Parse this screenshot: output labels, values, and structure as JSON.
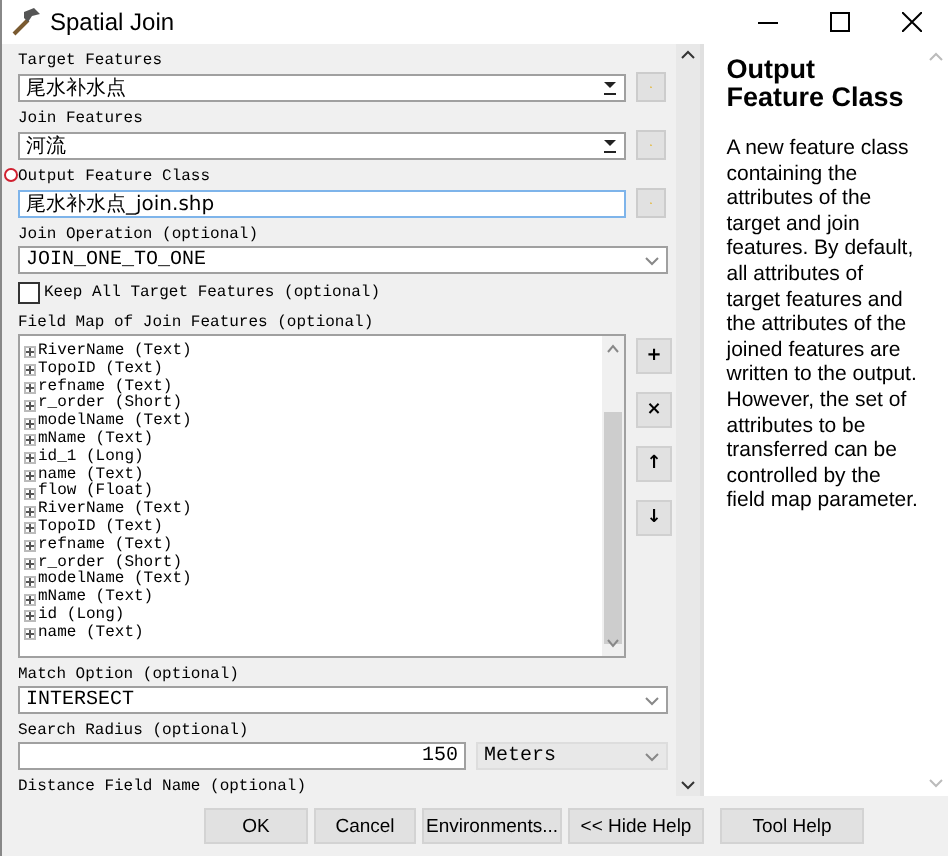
{
  "window": {
    "title": "Spatial Join"
  },
  "parameters": [
    {
      "kind": "combo",
      "label": "Target Features",
      "value": "尾水补水点",
      "browse": true,
      "error": false
    },
    {
      "kind": "combo",
      "label": "Join Features",
      "value": "河流",
      "browse": true,
      "error": false
    },
    {
      "kind": "text",
      "label": "Output Feature Class",
      "value": "尾水补水点_join.shp",
      "browse": true,
      "error": true
    },
    {
      "kind": "select",
      "label": "Join Operation (optional)",
      "value": "JOIN_ONE_TO_ONE",
      "browse": false,
      "error": false
    },
    {
      "kind": "checkbox",
      "label": "Keep All Target Features (optional)",
      "checked": false,
      "browse": false,
      "error": false
    },
    {
      "kind": "fieldmap",
      "label": "Field Map of Join Features (optional)",
      "browse": false,
      "error": false,
      "tools": [
        "+",
        "×",
        "↑",
        "↓"
      ],
      "fields": [
        {
          "text": "RiverName (Text)",
          "expanded": false
        },
        {
          "text": "TopoID (Text)",
          "expanded": false
        },
        {
          "text": "refname (Text)",
          "expanded": false
        },
        {
          "text": "r_order (Short)",
          "expanded": false
        },
        {
          "text": "modelName (Text)",
          "expanded": false
        },
        {
          "text": "mName (Text)",
          "expanded": false
        },
        {
          "text": "id_1 (Long)",
          "expanded": false
        },
        {
          "text": "name (Text)",
          "expanded": false
        },
        {
          "text": "flow (Float)",
          "expanded": false
        },
        {
          "text": "RiverName (Text)",
          "expanded": false
        },
        {
          "text": "TopoID (Text)",
          "expanded": false
        },
        {
          "text": "refname (Text)",
          "expanded": false
        },
        {
          "text": "r_order (Short)",
          "expanded": false
        },
        {
          "text": "modelName (Text)",
          "expanded": false
        },
        {
          "text": "mName (Text)",
          "expanded": false
        },
        {
          "text": "id (Long)",
          "expanded": false
        },
        {
          "text": "name (Text)",
          "expanded": false
        }
      ]
    },
    {
      "kind": "select",
      "label": "Match Option (optional)",
      "value": "INTERSECT",
      "browse": false,
      "error": false
    },
    {
      "kind": "radius",
      "label": "Search Radius (optional)",
      "value": "150",
      "unit": "Meters",
      "browse": false,
      "error": false
    },
    {
      "kind": "label",
      "label": "Distance Field Name (optional)",
      "browse": false,
      "error": false
    }
  ],
  "help": {
    "title": "Output Feature Class",
    "text": "A new feature class containing the attributes of the target and join features. By default, all attributes of target features and the attributes of the joined features are written to the output. However, the set of attributes to be transferred can be controlled by the field map parameter."
  },
  "buttons": [
    {
      "label": "OK"
    },
    {
      "label": "Cancel"
    },
    {
      "label": "Environments..."
    },
    {
      "label": "<< Hide Help"
    },
    {
      "label": "Tool Help"
    }
  ]
}
